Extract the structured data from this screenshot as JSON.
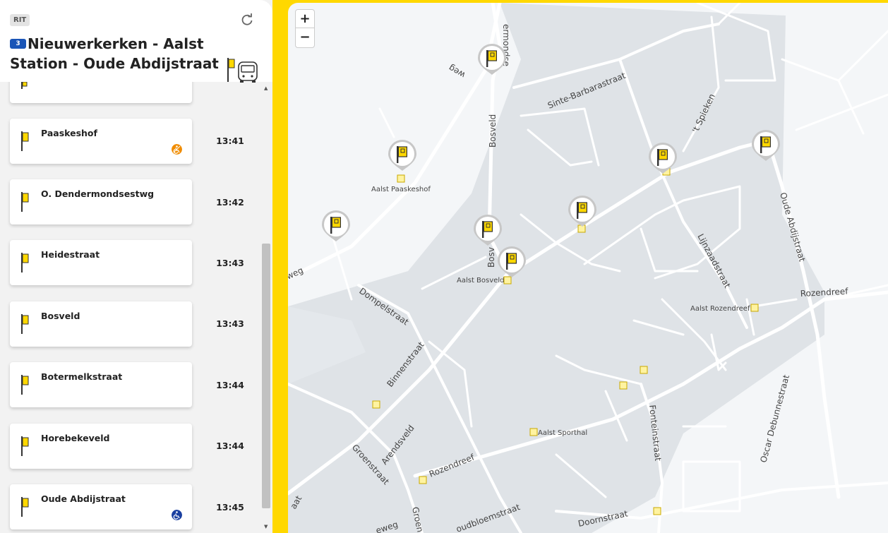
{
  "panel": {
    "tag": "RIT",
    "line_number": "3",
    "route_title": "Nieuwerkerken - Aalst Station - Oude Abdijstraat",
    "stops": [
      {
        "name": "Paaskeshof",
        "time": "13:41",
        "access": "partial"
      },
      {
        "name": "O. Dendermondsestwg",
        "time": "13:42",
        "access": "none"
      },
      {
        "name": "Heidestraat",
        "time": "13:43",
        "access": "none"
      },
      {
        "name": "Bosveld",
        "time": "13:43",
        "access": "none"
      },
      {
        "name": "Botermelkstraat",
        "time": "13:44",
        "access": "none"
      },
      {
        "name": "Horebekeveld",
        "time": "13:44",
        "access": "none"
      },
      {
        "name": "Oude Abdijstraat",
        "time": "13:45",
        "access": "full"
      }
    ]
  },
  "map": {
    "zoom_in": "+",
    "zoom_out": "−",
    "street_labels": {
      "dendermondse": "ermondse",
      "weg_top": "weg",
      "sinte_barbara": "Sinte-Barbarastraat",
      "spieken": "'t Spieken",
      "bosveld_v": "Bosveld",
      "bosveld_v2": "Bosv",
      "oude_abdij": "Oude Abdijstraat",
      "weg_left": "weg",
      "dompel": "Dompelstraat",
      "lijnzaad": "Lijnzaadstraat",
      "rozendreef_r": "Rozendreef",
      "binnen": "Binnenstraat",
      "arends": "Arendsveld",
      "groen": "Groenstraat",
      "rozendreef_l": "Rozendreef",
      "fontein": "Fonteinstraat",
      "oscar": "Oscar Debunnestraat",
      "doorn": "Doornstraat",
      "oudbloem": "oudbloemstraat",
      "groen2": "Groen",
      "eweg": "eweg",
      "aat": "aat"
    },
    "stop_labels": {
      "paaskeshof": "Aalst Paaskeshof",
      "bosveld": "Aalst Bosveld",
      "rozendreef": "Aalst Rozendreef",
      "sporthal": "Aalst Sporthal"
    }
  },
  "colors": {
    "accent": "#ffd800",
    "line_badge": "#1a55b7",
    "partial_access": "#f08c00",
    "full_access": "#1a3fa0"
  }
}
